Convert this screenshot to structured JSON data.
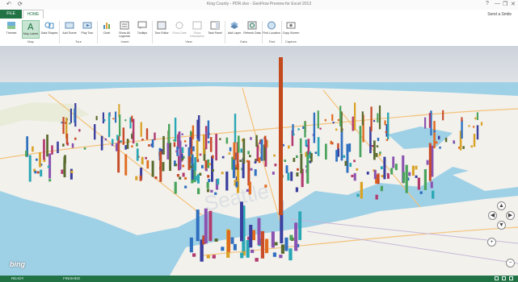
{
  "window": {
    "title": "King County - PDR.xlsx - GeoFlow Preview for Excel 2013",
    "quick_access": [
      "↶",
      "⟳"
    ],
    "controls": {
      "help": "?",
      "minimize": "—",
      "restore": "❐",
      "close": "✕"
    }
  },
  "tabs": {
    "file": "FILE",
    "home": "HOME"
  },
  "signin": "Send a Smile",
  "ribbon": {
    "buttons": [
      {
        "id": "themes",
        "label": "Themes",
        "icon": "themes-icon"
      },
      {
        "id": "map-labels",
        "label": "Map Labels",
        "icon": "map-labels-icon",
        "active": true
      },
      {
        "id": "data-shapes",
        "label": "Data Shapes",
        "icon": "data-shapes-icon"
      },
      {
        "id": "add-scene",
        "label": "Add Scene",
        "icon": "add-scene-icon"
      },
      {
        "id": "play-tour",
        "label": "Play Tour",
        "icon": "play-tour-icon"
      },
      {
        "id": "chart",
        "label": "Chart",
        "icon": "chart-icon"
      },
      {
        "id": "show-all-legends",
        "label": "Show All Legends",
        "icon": "legends-icon"
      },
      {
        "id": "tooltips",
        "label": "Tooltips",
        "icon": "tooltips-icon"
      },
      {
        "id": "tour-editor",
        "label": "Tour Editor",
        "icon": "tour-editor-icon"
      },
      {
        "id": "show-date",
        "label": "Show Date",
        "icon": "show-date-icon"
      },
      {
        "id": "show-description",
        "label": "Show Description",
        "icon": "show-description-icon"
      },
      {
        "id": "task-panel",
        "label": "Task Panel",
        "icon": "task-panel-icon"
      },
      {
        "id": "add-layer",
        "label": "Add Layer",
        "icon": "add-layer-icon"
      },
      {
        "id": "refresh-data",
        "label": "Refresh Data",
        "icon": "refresh-data-icon"
      },
      {
        "id": "find-location",
        "label": "Find Location",
        "icon": "find-location-icon"
      },
      {
        "id": "copy-screen",
        "label": "Copy Screen",
        "icon": "copy-screen-icon"
      }
    ],
    "groups": [
      "Map",
      "Tour",
      "Insert",
      "View",
      "Data",
      "Find",
      "Capture"
    ]
  },
  "map": {
    "watermark": "Seattle",
    "brand": "bing",
    "nav_controls": {
      "up": "▲",
      "left": "◀",
      "right": "▶",
      "down": "▼",
      "zoom_in": "+",
      "zoom_out": "−"
    }
  },
  "status": {
    "ready": "READY",
    "finished": "FINISHED"
  },
  "colors": {
    "accent": "#217346",
    "water": "#9ed0e6",
    "land": "#f2f1ec"
  }
}
